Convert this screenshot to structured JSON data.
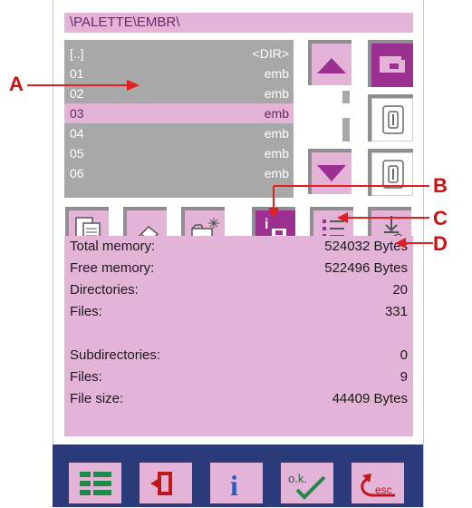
{
  "path": "\\PALETTE\\EMBR\\",
  "files": [
    {
      "name": "[..]",
      "type": "<DIR>",
      "selected": false
    },
    {
      "name": "01",
      "type": "emb",
      "selected": false
    },
    {
      "name": "02",
      "type": "emb",
      "selected": false
    },
    {
      "name": "03",
      "type": "emb",
      "selected": true
    },
    {
      "name": "04",
      "type": "emb",
      "selected": false
    },
    {
      "name": "05",
      "type": "emb",
      "selected": false
    },
    {
      "name": "06",
      "type": "emb",
      "selected": false
    }
  ],
  "info": {
    "total_memory_label": "Total memory:",
    "total_memory_value": "524032 Bytes",
    "free_memory_label": "Free memory:",
    "free_memory_value": "522496 Bytes",
    "directories_label": "Directories:",
    "directories_value": "20",
    "files_label": "Files:",
    "files_value": "331",
    "subdirectories_label": "Subdirectories:",
    "subdirectories_value": "0",
    "files2_label": "Files:",
    "files2_value": "9",
    "file_size_label": "File size:",
    "file_size_value": "44409 Bytes"
  },
  "callouts": {
    "a": "A",
    "b": "B",
    "c": "C",
    "d": "D"
  },
  "bottom": {
    "info_glyph": "i",
    "ok_label": "o.k.",
    "esc_label": "esc"
  },
  "colors": {
    "pink": "#e4b4d8",
    "purple": "#9b3091",
    "gray": "#a8a8a8",
    "navy": "#2b3b7a",
    "callout_red": "#cc1010"
  }
}
